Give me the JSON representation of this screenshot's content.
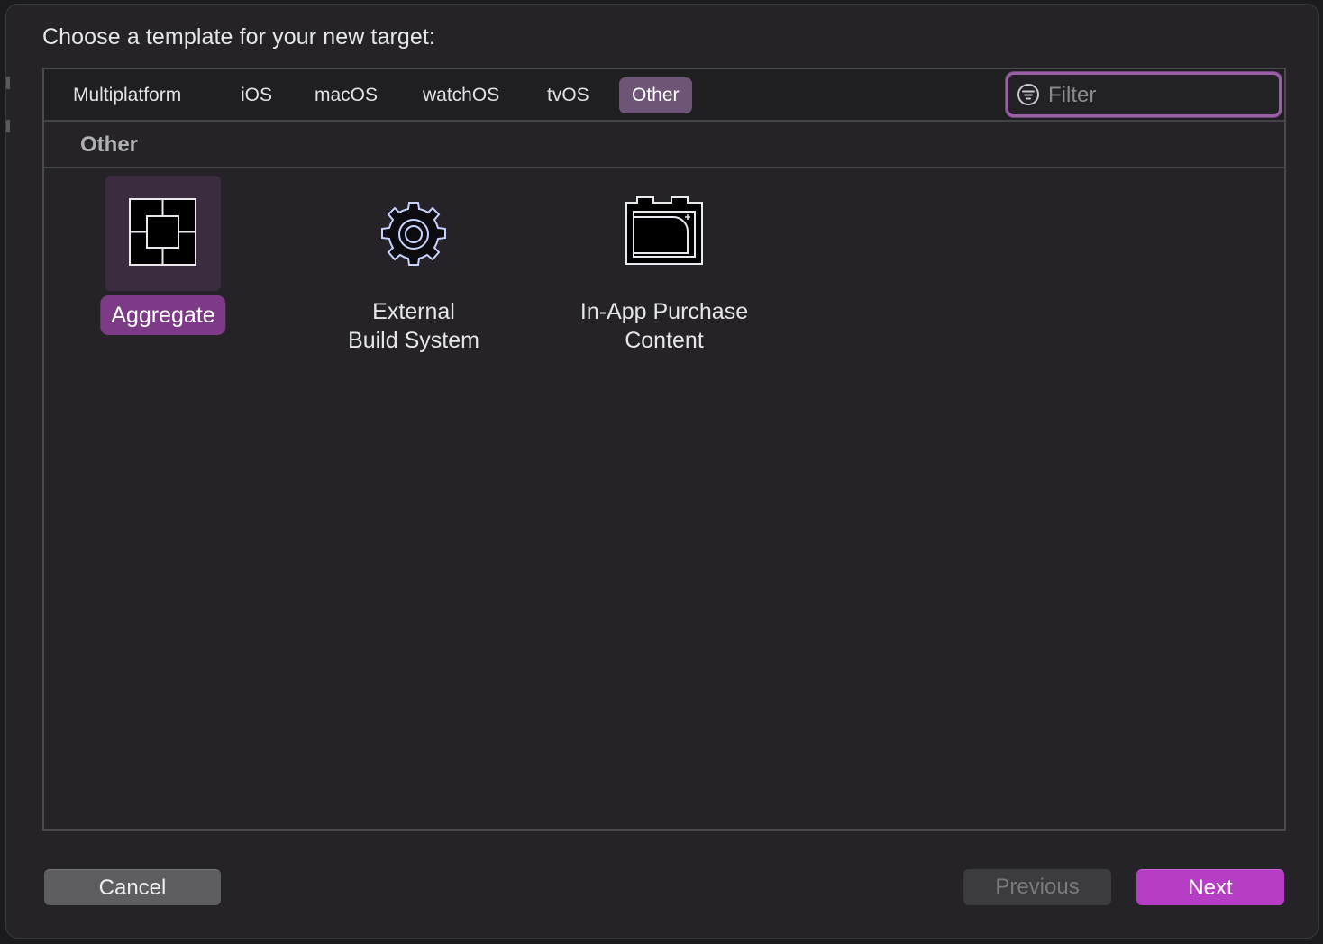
{
  "dialog": {
    "prompt": "Choose a template for your new target:"
  },
  "tabs": [
    {
      "label": "Multiplatform",
      "active": false
    },
    {
      "label": "iOS",
      "active": false
    },
    {
      "label": "macOS",
      "active": false
    },
    {
      "label": "watchOS",
      "active": false
    },
    {
      "label": "tvOS",
      "active": false
    },
    {
      "label": "Other",
      "active": true
    }
  ],
  "filter": {
    "placeholder": "Filter",
    "value": "",
    "icon": "filter-icon"
  },
  "section": {
    "title": "Other"
  },
  "templates": [
    {
      "name": "Aggregate",
      "lines": [
        "Aggregate"
      ],
      "icon": "aggregate-icon",
      "selected": true
    },
    {
      "name": "External Build System",
      "lines": [
        "External",
        "Build System"
      ],
      "icon": "gear-icon",
      "selected": false
    },
    {
      "name": "In-App Purchase Content",
      "lines": [
        "In-App Purchase",
        "Content"
      ],
      "icon": "in-app-purchase-icon",
      "selected": false
    }
  ],
  "buttons": {
    "cancel": "Cancel",
    "previous": "Previous",
    "next": "Next"
  },
  "colors": {
    "accent": "#b53ec4",
    "selection": "#7d3a86",
    "active_tab": "#6e5577",
    "background": "#252327"
  }
}
